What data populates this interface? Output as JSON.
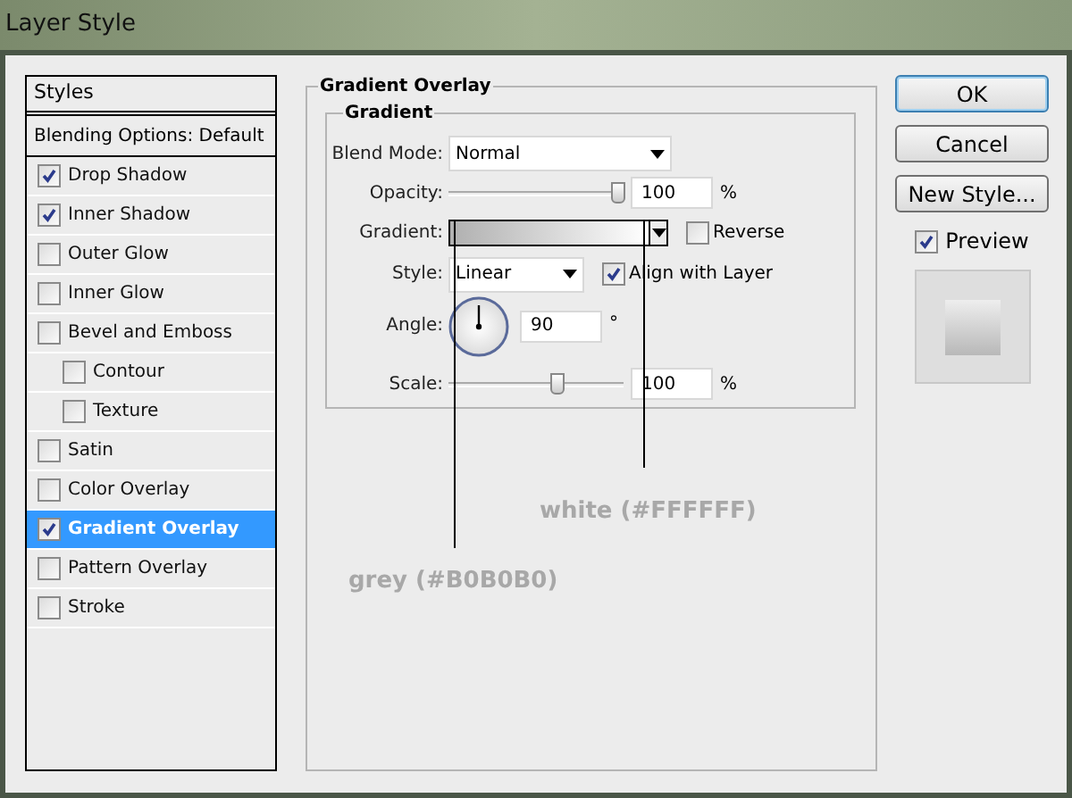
{
  "window": {
    "title": "Layer Style"
  },
  "styles_panel": {
    "header": "Styles",
    "blending_options": "Blending Options: Default",
    "items": [
      {
        "label": "Drop Shadow",
        "checked": true,
        "selected": false
      },
      {
        "label": "Inner Shadow",
        "checked": true,
        "selected": false
      },
      {
        "label": "Outer Glow",
        "checked": false,
        "selected": false
      },
      {
        "label": "Inner Glow",
        "checked": false,
        "selected": false
      },
      {
        "label": "Bevel and Emboss",
        "checked": false,
        "selected": false,
        "children": [
          {
            "label": "Contour",
            "checked": false,
            "selected": false
          },
          {
            "label": "Texture",
            "checked": false,
            "selected": false
          }
        ]
      },
      {
        "label": "Satin",
        "checked": false,
        "selected": false
      },
      {
        "label": "Color Overlay",
        "checked": false,
        "selected": false
      },
      {
        "label": "Gradient Overlay",
        "checked": true,
        "selected": true
      },
      {
        "label": "Pattern Overlay",
        "checked": false,
        "selected": false
      },
      {
        "label": "Stroke",
        "checked": false,
        "selected": false
      }
    ]
  },
  "gradient_overlay": {
    "title": "Gradient Overlay",
    "group_title": "Gradient",
    "blend_mode": {
      "label": "Blend Mode:",
      "value": "Normal"
    },
    "opacity": {
      "label": "Opacity:",
      "level": 0.97,
      "value": "100",
      "unit": "%"
    },
    "gradient": {
      "label": "Gradient:",
      "reverse": {
        "label": "Reverse",
        "checked": false
      }
    },
    "style": {
      "label": "Style:",
      "value": "Linear",
      "align": {
        "label": "Align with Layer",
        "checked": true
      }
    },
    "angle": {
      "label": "Angle:",
      "value": "90",
      "unit": "°"
    },
    "scale": {
      "label": "Scale:",
      "level": 0.62,
      "value": "100",
      "unit": "%"
    }
  },
  "buttons": [
    {
      "label": "OK",
      "default": true
    },
    {
      "label": "Cancel",
      "default": false
    },
    {
      "label": "New Style...",
      "default": false
    }
  ],
  "preview": {
    "label": "Preview",
    "checked": true
  },
  "annotations": [
    {
      "text": "white (#FFFFFF)"
    },
    {
      "text": "grey (#B0B0B0)"
    }
  ]
}
